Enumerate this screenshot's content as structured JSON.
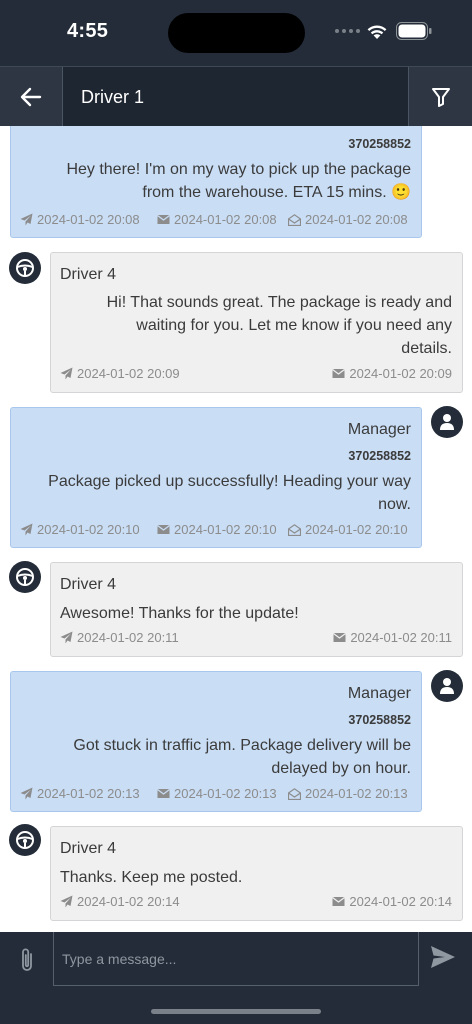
{
  "status": {
    "time": "4:55"
  },
  "header": {
    "title": "Driver 1"
  },
  "messages": [
    {
      "type": "sent",
      "phone": "370258852",
      "text_lines": [
        "Hey there! I'm on my way to pick up the package",
        "from the warehouse. ETA 15 mins. 🙂"
      ],
      "sent_at": "2024-01-02 20:08",
      "delivered_at": "2024-01-02 20:08",
      "read_at": "2024-01-02 20:08"
    },
    {
      "type": "received",
      "sender": "Driver 4",
      "text_lines": [
        "Hi! That sounds great. The package is ready and",
        "waiting for you. Let me know if you need any",
        "details."
      ],
      "sent_at": "2024-01-02 20:09",
      "delivered_at": "2024-01-02 20:09"
    },
    {
      "type": "sent",
      "sender": "Manager",
      "phone": "370258852",
      "text_lines": [
        "Package picked up successfully! Heading your way",
        "now."
      ],
      "sent_at": "2024-01-02 20:10",
      "delivered_at": "2024-01-02 20:10",
      "read_at": "2024-01-02 20:10"
    },
    {
      "type": "received",
      "sender": "Driver 4",
      "text_lines": [
        "Awesome! Thanks for the update!"
      ],
      "sent_at": "2024-01-02 20:11",
      "delivered_at": "2024-01-02 20:11"
    },
    {
      "type": "sent",
      "sender": "Manager",
      "phone": "370258852",
      "text_lines": [
        "Got stuck in traffic jam. Package delivery will be",
        "delayed by on hour."
      ],
      "sent_at": "2024-01-02 20:13",
      "delivered_at": "2024-01-02 20:13",
      "read_at": "2024-01-02 20:13"
    },
    {
      "type": "received",
      "sender": "Driver 4",
      "text_lines": [
        "Thanks. Keep me posted."
      ],
      "sent_at": "2024-01-02 20:14",
      "delivered_at": "2024-01-02 20:14"
    }
  ],
  "composer": {
    "placeholder": "Type a message..."
  },
  "icons": {
    "back": "arrow-left-icon",
    "filter": "filter-icon",
    "attach": "paperclip-icon",
    "send": "send-icon",
    "driver_avatar": "steering-wheel-icon",
    "manager_avatar": "person-icon",
    "sent": "paper-plane-icon",
    "delivered": "envelope-icon",
    "read": "envelope-open-icon"
  },
  "colors": {
    "dark_bar": "#232c38",
    "sent_bubble": "#c9ddf5",
    "received_bubble": "#f0f0f1"
  }
}
